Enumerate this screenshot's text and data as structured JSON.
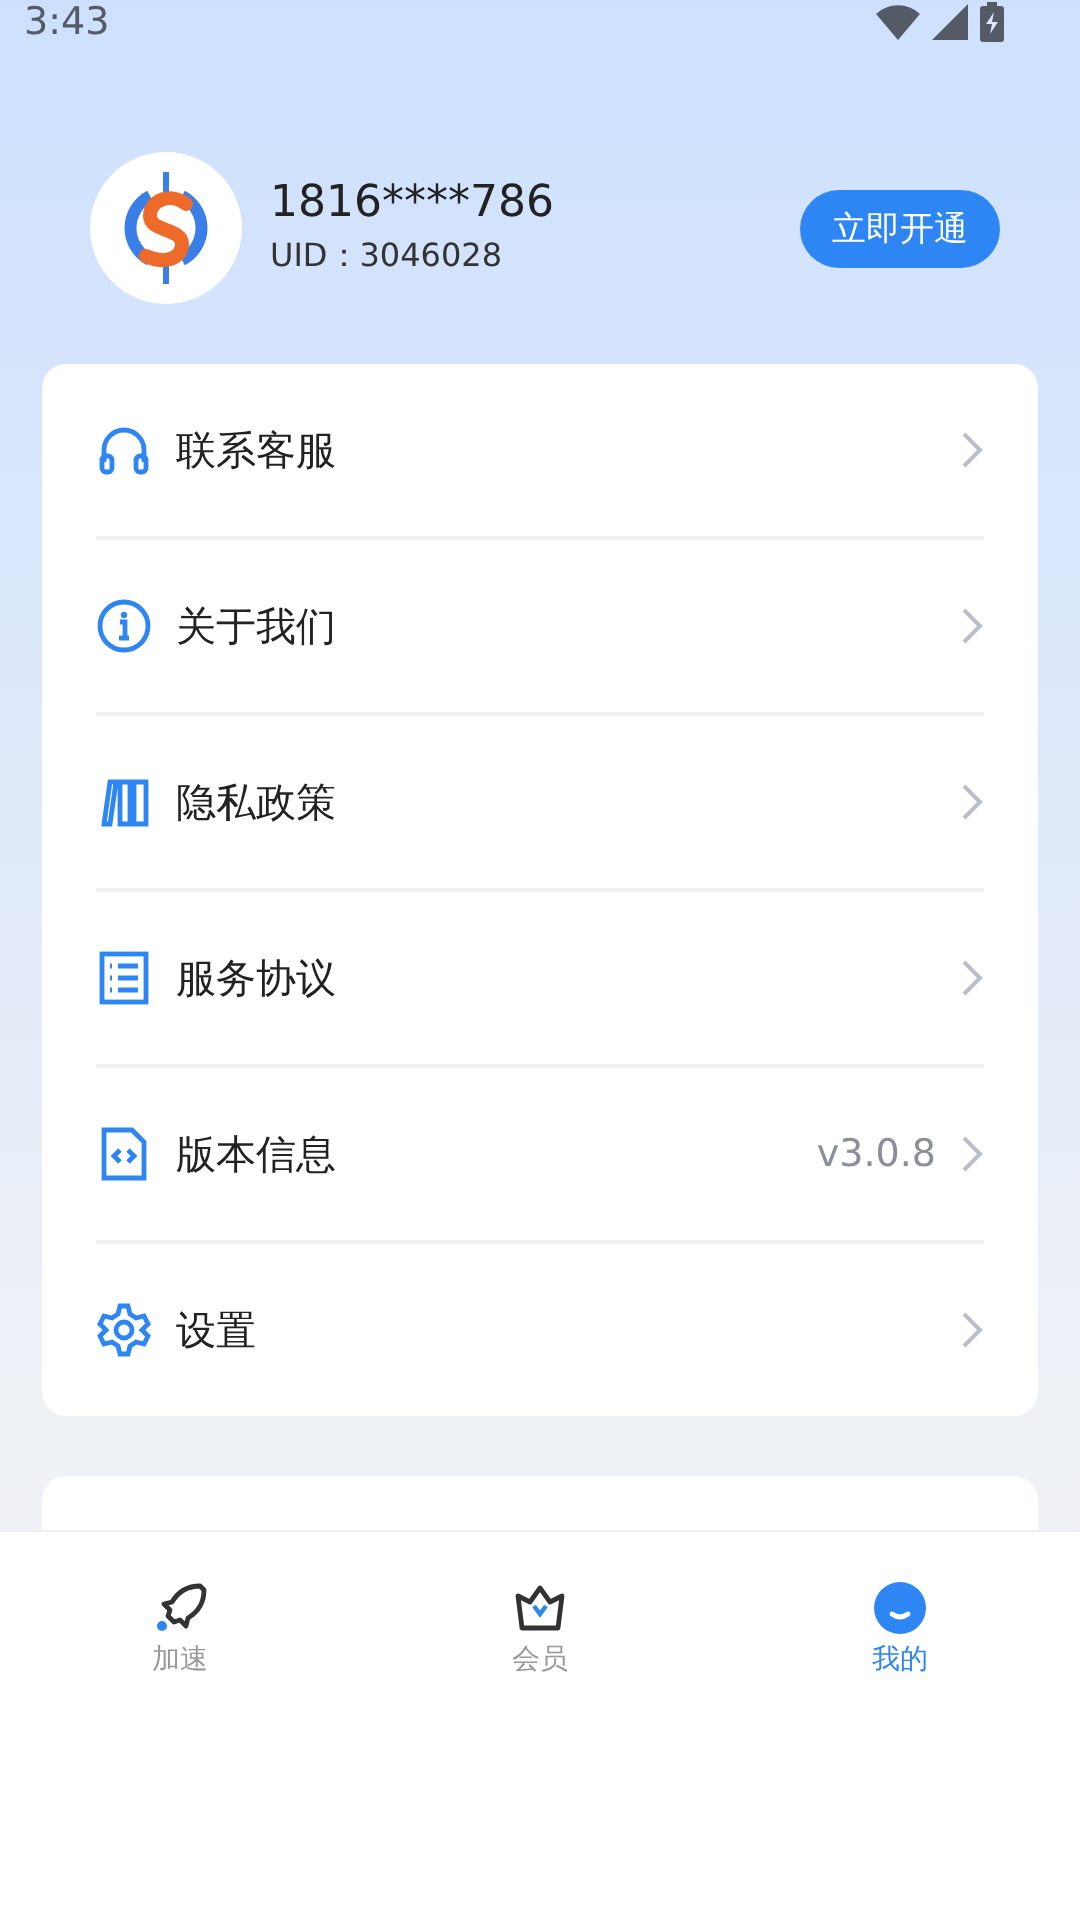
{
  "status_bar": {
    "time": "3:43"
  },
  "profile": {
    "phone": "1816****786",
    "uid": "UID：3046028",
    "button": "立即开通"
  },
  "menu": [
    {
      "kind": "headset",
      "label": "联系客服"
    },
    {
      "kind": "info",
      "label": "关于我们"
    },
    {
      "kind": "books",
      "label": "隐私政策"
    },
    {
      "kind": "list",
      "label": "服务协议"
    },
    {
      "kind": "file",
      "label": "版本信息",
      "value": "v3.0.8"
    },
    {
      "kind": "gear",
      "label": "设置"
    }
  ],
  "tabs": [
    {
      "kind": "rocket",
      "label": "加速",
      "selected": false
    },
    {
      "kind": "crown",
      "label": "会员",
      "selected": false
    },
    {
      "kind": "face",
      "label": "我的",
      "selected": true
    }
  ]
}
